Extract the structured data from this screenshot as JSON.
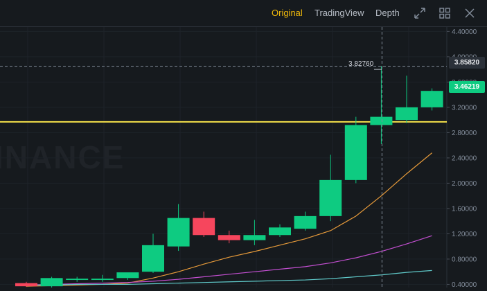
{
  "toolbar": {
    "tabs": [
      {
        "label": "Original",
        "active": true
      },
      {
        "label": "TradingView",
        "active": false
      },
      {
        "label": "Depth",
        "active": false
      }
    ],
    "icons": [
      "expand-icon",
      "grid-icon",
      "close-icon"
    ]
  },
  "watermark": "INANCE",
  "crosshair": {
    "price_label": "3.82760",
    "axis_label": "3.85820"
  },
  "last_price_label": "3.46219",
  "colors": {
    "background": "#161a1e",
    "up": "#0ecb81",
    "down": "#f6465d",
    "accent": "#f0b90b",
    "hline": "#f5e14a",
    "ma1": "#e69a3a",
    "ma2": "#c44fd2",
    "ma3": "#5fc9c9"
  },
  "chart_data": {
    "type": "candlestick",
    "y_ticks": [
      "4.40000",
      "4.00000",
      "3.60000",
      "3.20000",
      "2.80000",
      "2.40000",
      "2.00000",
      "1.60000",
      "1.20000",
      "0.80000",
      "0.40000"
    ],
    "ylim": [
      0.35,
      4.47
    ],
    "horizontal_line": 2.97,
    "candles": [
      {
        "o": 0.42,
        "h": 0.44,
        "l": 0.36,
        "c": 0.37
      },
      {
        "o": 0.37,
        "h": 0.52,
        "l": 0.35,
        "c": 0.5
      },
      {
        "o": 0.47,
        "h": 0.52,
        "l": 0.44,
        "c": 0.49
      },
      {
        "o": 0.47,
        "h": 0.55,
        "l": 0.44,
        "c": 0.49
      },
      {
        "o": 0.5,
        "h": 0.58,
        "l": 0.47,
        "c": 0.59
      },
      {
        "o": 0.6,
        "h": 1.2,
        "l": 0.58,
        "c": 1.02
      },
      {
        "o": 1.0,
        "h": 1.67,
        "l": 0.93,
        "c": 1.45
      },
      {
        "o": 1.45,
        "h": 1.55,
        "l": 1.15,
        "c": 1.18
      },
      {
        "o": 1.18,
        "h": 1.25,
        "l": 1.05,
        "c": 1.1
      },
      {
        "o": 1.1,
        "h": 1.42,
        "l": 1.02,
        "c": 1.18
      },
      {
        "o": 1.18,
        "h": 1.35,
        "l": 1.15,
        "c": 1.3
      },
      {
        "o": 1.28,
        "h": 1.55,
        "l": 1.25,
        "c": 1.48
      },
      {
        "o": 1.48,
        "h": 2.45,
        "l": 1.4,
        "c": 2.05
      },
      {
        "o": 2.05,
        "h": 3.05,
        "l": 2.0,
        "c": 2.92
      },
      {
        "o": 2.92,
        "h": 3.85,
        "l": 2.62,
        "c": 3.05
      },
      {
        "o": 3.0,
        "h": 3.7,
        "l": 2.95,
        "c": 3.2
      },
      {
        "o": 3.2,
        "h": 3.5,
        "l": 3.15,
        "c": 3.46
      }
    ],
    "ma_lines": [
      {
        "name": "MA1",
        "values": [
          0.37,
          0.38,
          0.39,
          0.4,
          0.42,
          0.5,
          0.6,
          0.72,
          0.83,
          0.92,
          1.02,
          1.12,
          1.25,
          1.48,
          1.8,
          2.15,
          2.48
        ]
      },
      {
        "name": "MA2",
        "values": [
          0.39,
          0.4,
          0.41,
          0.42,
          0.43,
          0.45,
          0.48,
          0.52,
          0.56,
          0.6,
          0.64,
          0.68,
          0.74,
          0.82,
          0.92,
          1.04,
          1.17
        ]
      },
      {
        "name": "MA3",
        "values": [
          0.39,
          0.39,
          0.4,
          0.4,
          0.4,
          0.41,
          0.42,
          0.43,
          0.44,
          0.45,
          0.46,
          0.47,
          0.49,
          0.52,
          0.55,
          0.59,
          0.62
        ]
      }
    ]
  }
}
